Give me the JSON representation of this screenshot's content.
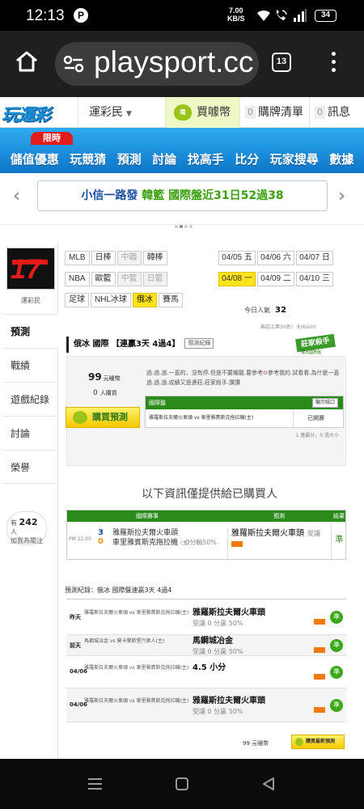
{
  "status_bar": {
    "time": "12:13",
    "app_icon": "P",
    "net_speed_value": "7.00",
    "net_speed_unit": "KB/S",
    "battery": "34",
    "icons": [
      "wifi-icon",
      "wifi-call-icon",
      "signal-icon",
      "battery-icon"
    ]
  },
  "browser": {
    "url": "playsport.cc",
    "tab_count": "13",
    "icons": [
      "home-icon",
      "tune-icon",
      "menu-icon"
    ]
  },
  "site_header": {
    "logo": "玩運彩",
    "user_dropdown": "運彩民",
    "buy_coin_icon": "噗",
    "buy_coin": "買噱幣",
    "cart_count": "0",
    "cart": "購牌清單",
    "messages_count": "0",
    "messages": "訊息"
  },
  "nav": {
    "promo_tag": "限時",
    "items": [
      "儲值優惠",
      "玩競猜",
      "預測",
      "討論",
      "找高手",
      "比分",
      "玩家搜尋",
      "數據"
    ]
  },
  "banner": {
    "text_a": "小信一路發 ",
    "text_b": "韓籃 國際盤近31日52過38",
    "prev": "‹",
    "next": "›"
  },
  "sidebar": {
    "avatar_text": "17",
    "username": "運彩民",
    "items": [
      "預測",
      "戰績",
      "遊戲紀錄",
      "討論",
      "榮譽"
    ],
    "active_index": 0,
    "online_prefix": "有",
    "online_count": "242",
    "online_suffix": "人",
    "online_label": "加我為關注"
  },
  "leagues": {
    "rows": [
      [
        {
          "label": "MLB",
          "state": "normal"
        },
        {
          "label": "日棒",
          "state": "normal"
        },
        {
          "label": "中職",
          "state": "dim"
        },
        {
          "label": "韓棒",
          "state": "normal"
        }
      ],
      [
        {
          "label": "NBA",
          "state": "normal"
        },
        {
          "label": "歐籃",
          "state": "normal"
        },
        {
          "label": "中籃",
          "state": "dim"
        },
        {
          "label": "日籃",
          "state": "dim"
        }
      ],
      [
        {
          "label": "足球",
          "state": "normal"
        },
        {
          "label": "NHL冰球",
          "state": "normal"
        },
        {
          "label": "俄冰",
          "state": "sel"
        },
        {
          "label": "賽馬",
          "state": "normal"
        }
      ]
    ]
  },
  "dates": {
    "items": [
      {
        "label": "04/05 五",
        "state": "normal"
      },
      {
        "label": "04/06 六",
        "state": "normal"
      },
      {
        "label": "04/07 日",
        "state": "normal"
      },
      {
        "label": "04/08 一",
        "state": "sel"
      },
      {
        "label": "04/09 二",
        "state": "normal"
      },
      {
        "label": "04/10 三",
        "state": "normal"
      }
    ]
  },
  "popularity": {
    "label": "今日人氣",
    "value": "32",
    "prev_rank": "屆話上第30名！卡(Ksim)"
  },
  "expert_badge": {
    "label": "莊家殺手",
    "sub": "俄冰國際盤"
  },
  "prediction": {
    "header": "俄冰 國際 【連贏3天 4過4】",
    "record_button": "預測紀錄",
    "price": "99",
    "price_unit": "元噱幣",
    "buyers": "0",
    "buyers_unit": "人購買",
    "buy_button": "購買預測",
    "intro_a": "過.過.過.一直的，沒有停.但是不要耀龍.要參考",
    "intro_h": "⊙",
    "intro_b": "參考我的.試看看.為什麼一直過.過.過.成績又是連莊.莊家殺手.讚讚",
    "table_header": "國際盤",
    "table_button": "顯示賠口",
    "game": "雅羅斯拉夫爾火車頭 vs 車里雅賓斯克拖拉機(主)",
    "status": "已開賽",
    "pager": "1 連贏分，0 過大小"
  },
  "notice": "以下資訊僅提供給已購買人",
  "result_table": {
    "headers": [
      "國際賽事",
      "預測",
      "結果"
    ],
    "time": "PM 22:00",
    "score_a": "3",
    "score_b": "0",
    "team_a": "雅羅斯拉夫爾火車頭",
    "team_b": "車里雅賓斯克拖拉機",
    "team_b_tag": "(主)",
    "odds": "0分輸50%",
    "pick": "雅羅斯拉夫爾火車頭",
    "pick_note": "受讓",
    "result": "準"
  },
  "history": {
    "title": "預測紀錄：俄冰 國際盤連贏3天 4過4",
    "rows": [
      {
        "day": "昨天",
        "teams": "雅羅斯拉夫爾火車頭 vs 車里雅賓斯克拖拉機(主)",
        "pick": "雅羅斯拉夫爾火車頭",
        "note": "受讓 0 分贏 50%",
        "result": "準"
      },
      {
        "day": "前天",
        "teams": "馬鋼城冶金 vs 莫卡葉斯堡汽車人(主)",
        "pick": "馬鋼城冶金",
        "note": "受讓 0 分贏 50%",
        "result": "準"
      },
      {
        "day": "04/06",
        "teams": "雅羅斯拉夫爾火車頭 vs 車里雅賓斯克拖拉機(主)",
        "pick": "4.5 小分",
        "note": "",
        "result": "準"
      },
      {
        "day": "04/06",
        "teams": "雅羅斯拉夫爾火車頭 vs 車里雅賓斯克拖拉機(主)",
        "pick": "雅羅斯拉夫爾火車頭",
        "note": "受讓 0 分贏 50%",
        "result": "準"
      }
    ],
    "price": "99 元噱幣",
    "buy_button": "購買最新預測"
  },
  "system_nav": {
    "icons": [
      "recent-apps-icon",
      "home-icon",
      "back-icon"
    ]
  }
}
